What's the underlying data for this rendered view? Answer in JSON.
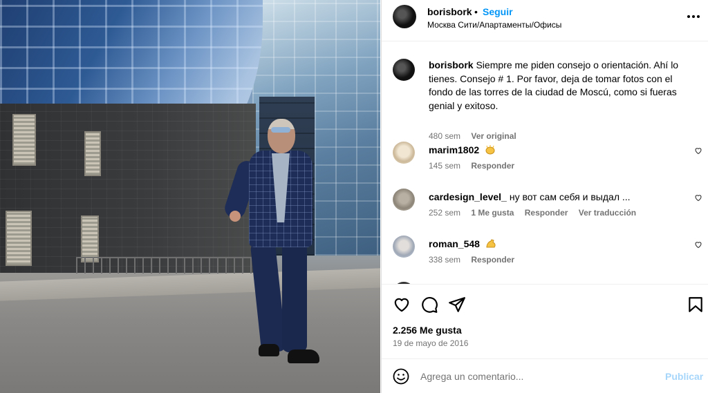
{
  "post": {
    "username": "borisbork",
    "separator": "•",
    "follow_label": "Seguir",
    "location": "Москва Сити/Апартаменты/Офисы",
    "more_label": "•••"
  },
  "caption": {
    "username": "borisbork",
    "text": "Siempre me piden consejo o orientación. Ahí lo tienes. Consejo # 1. Por favor, deja de tomar fotos con el fondo de las torres de la ciudad de Moscú, como si fueras genial y exitoso.",
    "time": "480 sem",
    "see_original": "Ver original"
  },
  "comments": [
    {
      "username": "marim1802",
      "text": "",
      "emoji": "clap-emoji",
      "time": "145 sem",
      "likes": "",
      "reply": "Responder",
      "translate": ""
    },
    {
      "username": "cardesign_level_",
      "text": "ну вот сам себя и выдал ...",
      "emoji": "",
      "time": "252 sem",
      "likes": "1 Me gusta",
      "reply": "Responder",
      "translate": "Ver traducción"
    },
    {
      "username": "roman_548",
      "text": "",
      "emoji": "flexed-biceps-emoji",
      "time": "338 sem",
      "likes": "",
      "reply": "Responder",
      "translate": ""
    }
  ],
  "actions": {
    "likes": "2.256 Me gusta",
    "date": "19 de mayo de 2016"
  },
  "add_comment": {
    "placeholder": "Agrega un comentario...",
    "post_label": "Publicar"
  },
  "colors": {
    "link_blue": "#0095f6",
    "muted": "#737373",
    "post_disabled": "#a7d6fb"
  }
}
